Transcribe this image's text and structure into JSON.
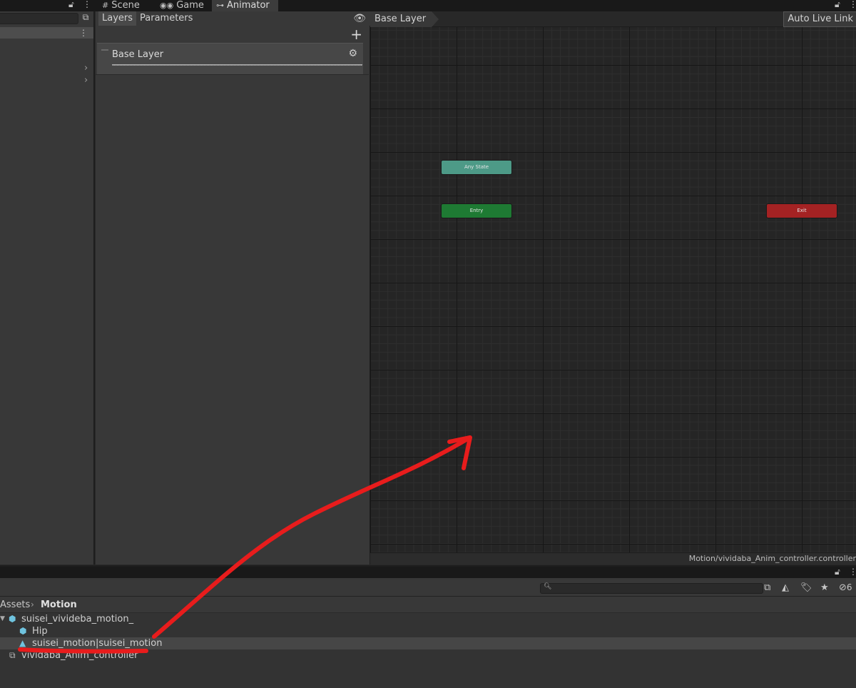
{
  "top_tabs": [
    {
      "label": "Scene",
      "icon": "hash-icon"
    },
    {
      "label": "Game",
      "icon": "gamepad-icon"
    },
    {
      "label": "Animator",
      "icon": "animator-icon"
    }
  ],
  "animator": {
    "subtabs": [
      "Layers",
      "Parameters"
    ],
    "layer_name": "Base Layer",
    "breadcrumb": "Base Layer",
    "auto_live_link": "Auto Live Link",
    "states": {
      "any_state": "Any State",
      "entry": "Entry",
      "exit": "Exit"
    },
    "asset_path": "Motion/vividaba_Anim_controller.controller"
  },
  "project": {
    "breadcrumb_root": "Assets",
    "breadcrumb_current": "Motion",
    "hidden_count": "6",
    "assets": [
      {
        "label": "suisei_vivideba_motion_",
        "icon": "model-icon"
      },
      {
        "label": "Hip",
        "icon": "model-icon"
      },
      {
        "label": "suisei_motion|suisei_motion",
        "icon": "animation-clip-icon"
      },
      {
        "label": "vividaba_Anim_controller",
        "icon": "animator-controller-icon"
      }
    ]
  },
  "colors": {
    "any_state": "#4d9a87",
    "entry": "#1e7a33",
    "exit": "#a42223",
    "annotation": "#e81c1c"
  }
}
